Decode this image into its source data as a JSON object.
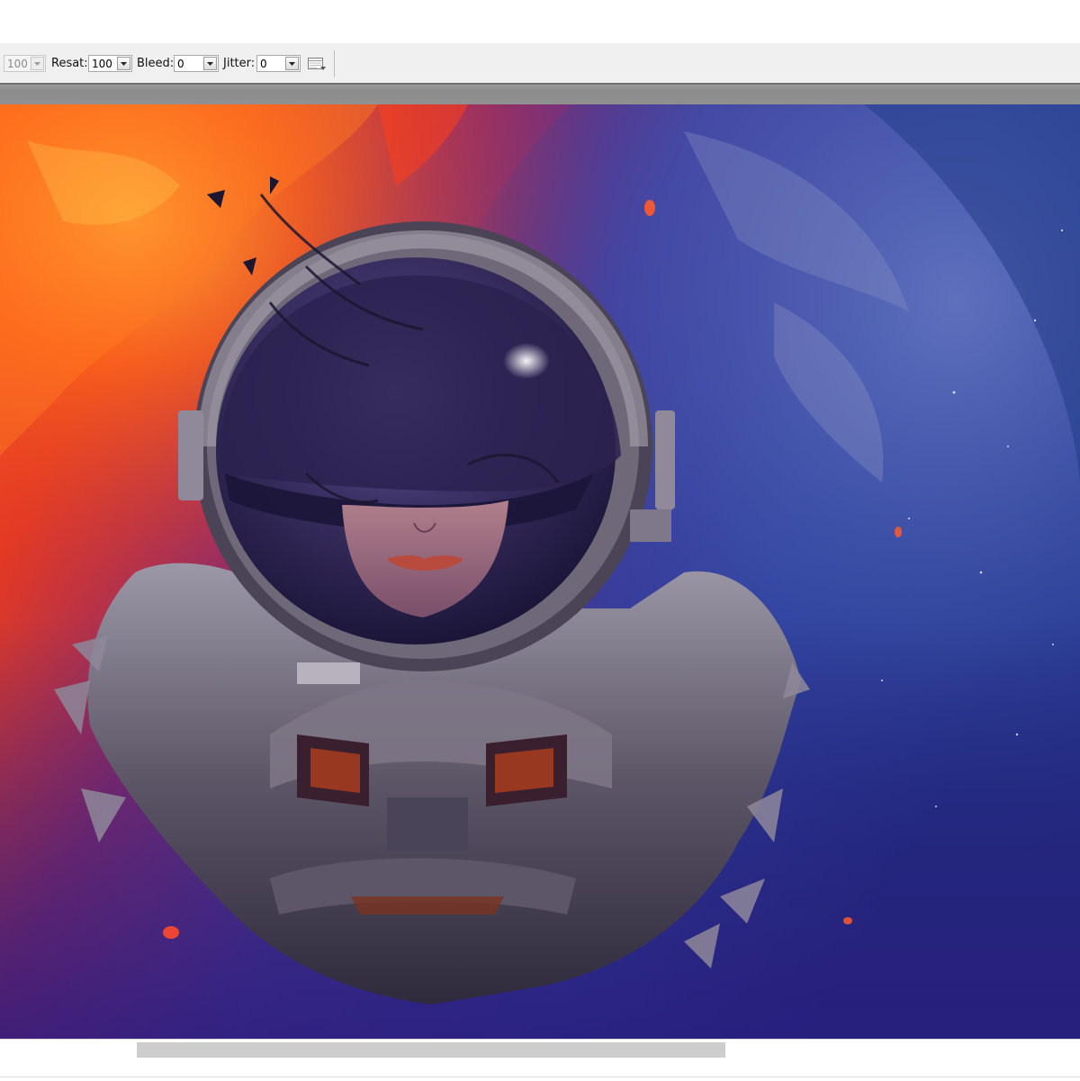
{
  "toolbar": {
    "first_field": {
      "value": "100",
      "disabled": true
    },
    "resat": {
      "label": "Resat:",
      "value": "100"
    },
    "bleed": {
      "label": "Bleed:",
      "value": "0"
    },
    "jitter": {
      "label": "Jitter:",
      "value": "0"
    },
    "options_icon": "options-grid-icon"
  },
  "canvas": {
    "image": "astronaut-space-artwork",
    "colors": {
      "fire": "#e8461c",
      "ember": "#ff7a1a",
      "space_blue": "#2a3a9a",
      "deep_purple": "#4a1f6e",
      "planet_blue": "#3a5cae"
    }
  },
  "scrollbar": {
    "thumb_color": "#cdcdcd"
  }
}
